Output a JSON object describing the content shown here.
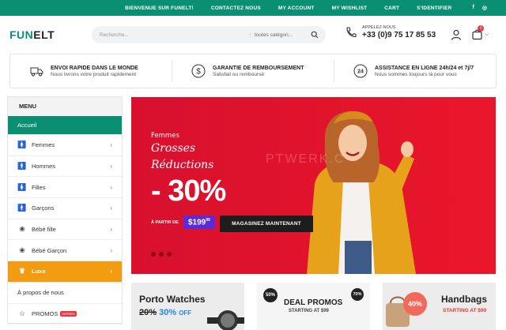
{
  "topbar": {
    "links": [
      "BIENVENUE SUR FUNELT!",
      "CONTACTEZ NOUS",
      "MY ACCOUNT",
      "MY WISHLIST",
      "CART",
      "S'IDENTIFIER"
    ],
    "social": [
      "f",
      "◎"
    ]
  },
  "header": {
    "logo_part1": "FUN",
    "logo_part2": "ELT",
    "search_placeholder": "Recherche...",
    "category_select": "toutes catégori...",
    "phone_label": "APPELEZ-NOUS",
    "phone_number": "+33 (0)9 75 17 85 53",
    "cart_count": "0"
  },
  "features": [
    {
      "title": "ENVOI RAPIDE DANS LE MONDE",
      "subtitle": "Nous livrons votre produit rapidement",
      "icon": "truck-icon"
    },
    {
      "title": "GARANTIE DE REMBOURSEMENT",
      "subtitle": "Satisfait ou remboursé",
      "icon": "dollar-icon"
    },
    {
      "title": "ASSISTANCE EN LIGNE 24h/24 et 7j/7",
      "subtitle": "Nous sommes toujours là pour vous",
      "icon": "support-24-icon"
    }
  ],
  "menu": {
    "title": "MENU",
    "items": [
      {
        "label": "Accueil"
      },
      {
        "label": "Femmes"
      },
      {
        "label": "Hommes"
      },
      {
        "label": "Filles"
      },
      {
        "label": "Garçons"
      },
      {
        "label": "Bébé fille"
      },
      {
        "label": "Bébé Garçon"
      },
      {
        "label": "Luxe"
      },
      {
        "label": "À propos de nous"
      },
      {
        "label": "PROMOS",
        "badge": "OFFRES"
      }
    ]
  },
  "hero": {
    "line1": "Femmes",
    "line2": "Grosses",
    "line3": "Réductions",
    "discount": "- 30%",
    "from_label": "À PARTIR DE",
    "price": "$199",
    "price_cents": "99",
    "cta": "MAGASINEZ MAINTENANT",
    "watermark": "PTWERK.C"
  },
  "cards": [
    {
      "title": "Porto Watches",
      "old": "20%",
      "new": "30%",
      "suffix": "OFF"
    },
    {
      "badge_left": "50%",
      "title": "DEAL PROMOS",
      "sub": "STARTING AT $99",
      "badge_right": "70%"
    },
    {
      "badge": "40%",
      "title": "Handbags",
      "sub": "STARTING AT $99"
    }
  ],
  "colors": {
    "brand_green": "#0a8f72",
    "hero_red": "#e3142c",
    "luxe_orange": "#f39c12",
    "price_purple": "#5a2bd6"
  }
}
